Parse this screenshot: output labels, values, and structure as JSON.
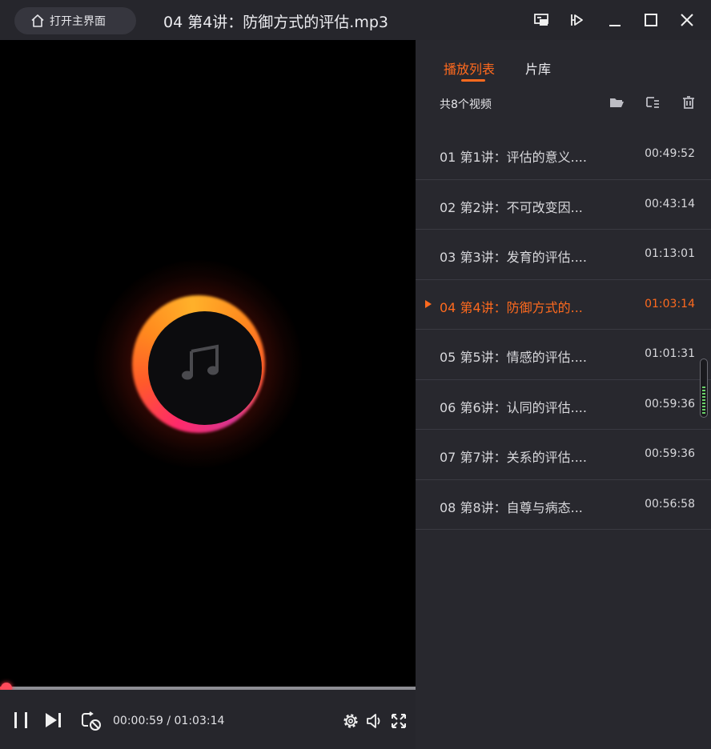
{
  "titlebar": {
    "home_label": "打开主界面",
    "title": "04 第4讲：防御方式的评估.mp3",
    "icons": [
      "home-icon",
      "screen-cast-icon",
      "pin-icon",
      "minimize-icon",
      "maximize-icon",
      "close-icon"
    ]
  },
  "player": {
    "time_current": "00:00:59",
    "time_separator": " / ",
    "time_total": "01:03:14",
    "progress_fraction": 0.016,
    "accent": "#ff4a4a",
    "icons": [
      "pause-icon",
      "next-icon",
      "loop-off-icon",
      "settings-icon",
      "volume-icon",
      "fullscreen-icon",
      "music-note-icon"
    ]
  },
  "sidebar": {
    "tabs": [
      {
        "label": "播放列表",
        "active": true
      },
      {
        "label": "片库",
        "active": false
      }
    ],
    "count_label": "共8个视频",
    "tools": [
      "open-folder-icon",
      "sort-icon",
      "delete-icon"
    ],
    "accent": "#ff6a1e",
    "items": [
      {
        "name": "01 第1讲：评估的意义....",
        "duration": "00:49:52",
        "current": false
      },
      {
        "name": "02 第2讲：不可改变因...",
        "duration": "00:43:14",
        "current": false
      },
      {
        "name": "03 第3讲：发育的评估....",
        "duration": "01:13:01",
        "current": false
      },
      {
        "name": "04 第4讲：防御方式的...",
        "duration": "01:03:14",
        "current": true
      },
      {
        "name": "05 第5讲：情感的评估....",
        "duration": "01:01:31",
        "current": false
      },
      {
        "name": "06 第6讲：认同的评估....",
        "duration": "00:59:36",
        "current": false
      },
      {
        "name": "07 第7讲：关系的评估....",
        "duration": "00:59:36",
        "current": false
      },
      {
        "name": "08 第8讲：自尊与病态...",
        "duration": "00:56:58",
        "current": false
      }
    ]
  }
}
